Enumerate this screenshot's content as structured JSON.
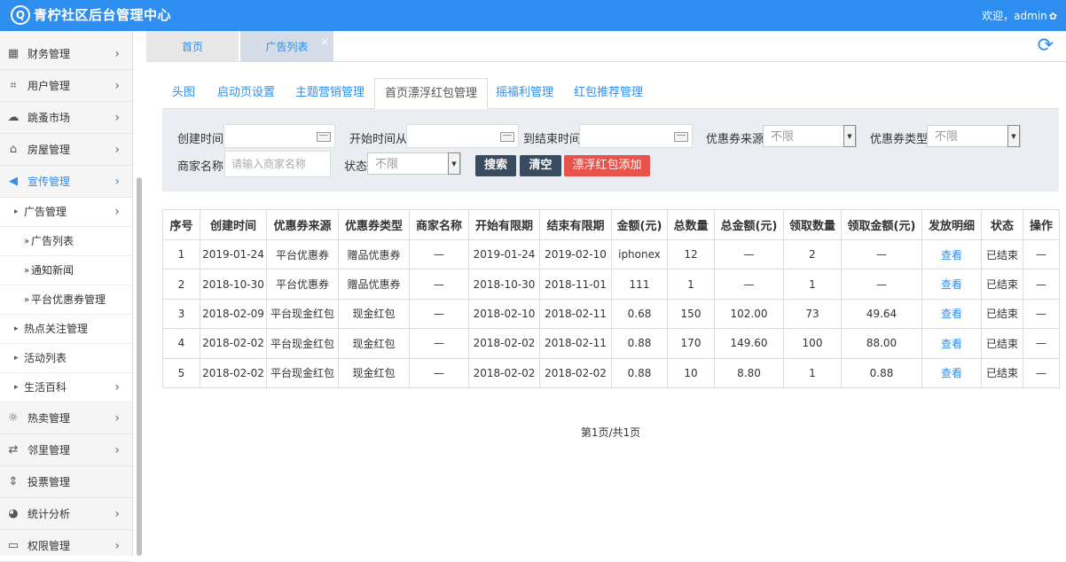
{
  "header": {
    "app_title": "青柠社区后台管理中心",
    "logo_text": "Q",
    "welcome": "欢迎，admin"
  },
  "sidebar": {
    "items": [
      {
        "label": "财务管理",
        "icon": "table-icon"
      },
      {
        "label": "用户管理",
        "icon": "crop-icon"
      },
      {
        "label": "跳蚤市场",
        "icon": "cloud-icon"
      },
      {
        "label": "房屋管理",
        "icon": "bank-icon"
      },
      {
        "label": "宣传管理",
        "icon": "volume-icon"
      }
    ],
    "sub_ad": "广告管理",
    "leaves": [
      "广告列表",
      "通知新闻",
      "平台优惠券管理"
    ],
    "sub_hot": "热点关注管理",
    "sub_activity": "活动列表",
    "sub_life": "生活百科",
    "items2": [
      {
        "label": "热卖管理",
        "icon": "sun-icon"
      },
      {
        "label": "邻里管理",
        "icon": "retweet-icon"
      },
      {
        "label": "投票管理",
        "icon": "sort-icon"
      },
      {
        "label": "统计分析",
        "icon": "pie-chart-icon"
      },
      {
        "label": "权限管理",
        "icon": "monitor-icon"
      }
    ]
  },
  "tabs": {
    "home": "首页",
    "ads": "广告列表",
    "close": "×"
  },
  "subnav": [
    "头图",
    "启动页设置",
    "主题营销管理",
    "首页漂浮红包管理",
    "摇福利管理",
    "红包推荐管理"
  ],
  "filter": {
    "created_time": "创建时间",
    "start_from": "开始时间从",
    "end_to": "到结束时间",
    "source": "优惠券来源",
    "source_value": "不限",
    "type": "优惠券类型",
    "type_value": "不限",
    "merchant": "商家名称:",
    "merchant_placeholder": "请输入商家名称",
    "status": "状态",
    "status_value": "不限",
    "search": "搜索",
    "clear": "清空",
    "add": "漂浮红包添加"
  },
  "table": {
    "headers": [
      "序号",
      "创建时间",
      "优惠券来源",
      "优惠券类型",
      "商家名称",
      "开始有限期",
      "结束有限期",
      "金额(元)",
      "总数量",
      "总金额(元)",
      "领取数量",
      "领取金额(元)",
      "发放明细",
      "状态",
      "操作"
    ],
    "rows": [
      [
        "1",
        "2019-01-24",
        "平台优惠券",
        "赠品优惠券",
        "—",
        "2019-01-24",
        "2019-02-10",
        "iphonex",
        "12",
        "—",
        "2",
        "—",
        "查看",
        "已结束",
        "—"
      ],
      [
        "2",
        "2018-10-30",
        "平台优惠券",
        "赠品优惠券",
        "—",
        "2018-10-30",
        "2018-11-01",
        "111",
        "1",
        "—",
        "1",
        "—",
        "查看",
        "已结束",
        "—"
      ],
      [
        "3",
        "2018-02-09",
        "平台现金红包",
        "现金红包",
        "—",
        "2018-02-10",
        "2018-02-11",
        "0.68",
        "150",
        "102.00",
        "73",
        "49.64",
        "查看",
        "已结束",
        "—"
      ],
      [
        "4",
        "2018-02-02",
        "平台现金红包",
        "现金红包",
        "—",
        "2018-02-02",
        "2018-02-11",
        "0.88",
        "170",
        "149.60",
        "100",
        "88.00",
        "查看",
        "已结束",
        "—"
      ],
      [
        "5",
        "2018-02-02",
        "平台现金红包",
        "现金红包",
        "—",
        "2018-02-02",
        "2018-02-02",
        "0.88",
        "10",
        "8.80",
        "1",
        "0.88",
        "查看",
        "已结束",
        "—"
      ]
    ]
  },
  "pager": "第1页/共1页",
  "colors": {
    "primary": "#2e8ef0",
    "dark_button": "#384b5f",
    "danger": "#e8524a"
  }
}
